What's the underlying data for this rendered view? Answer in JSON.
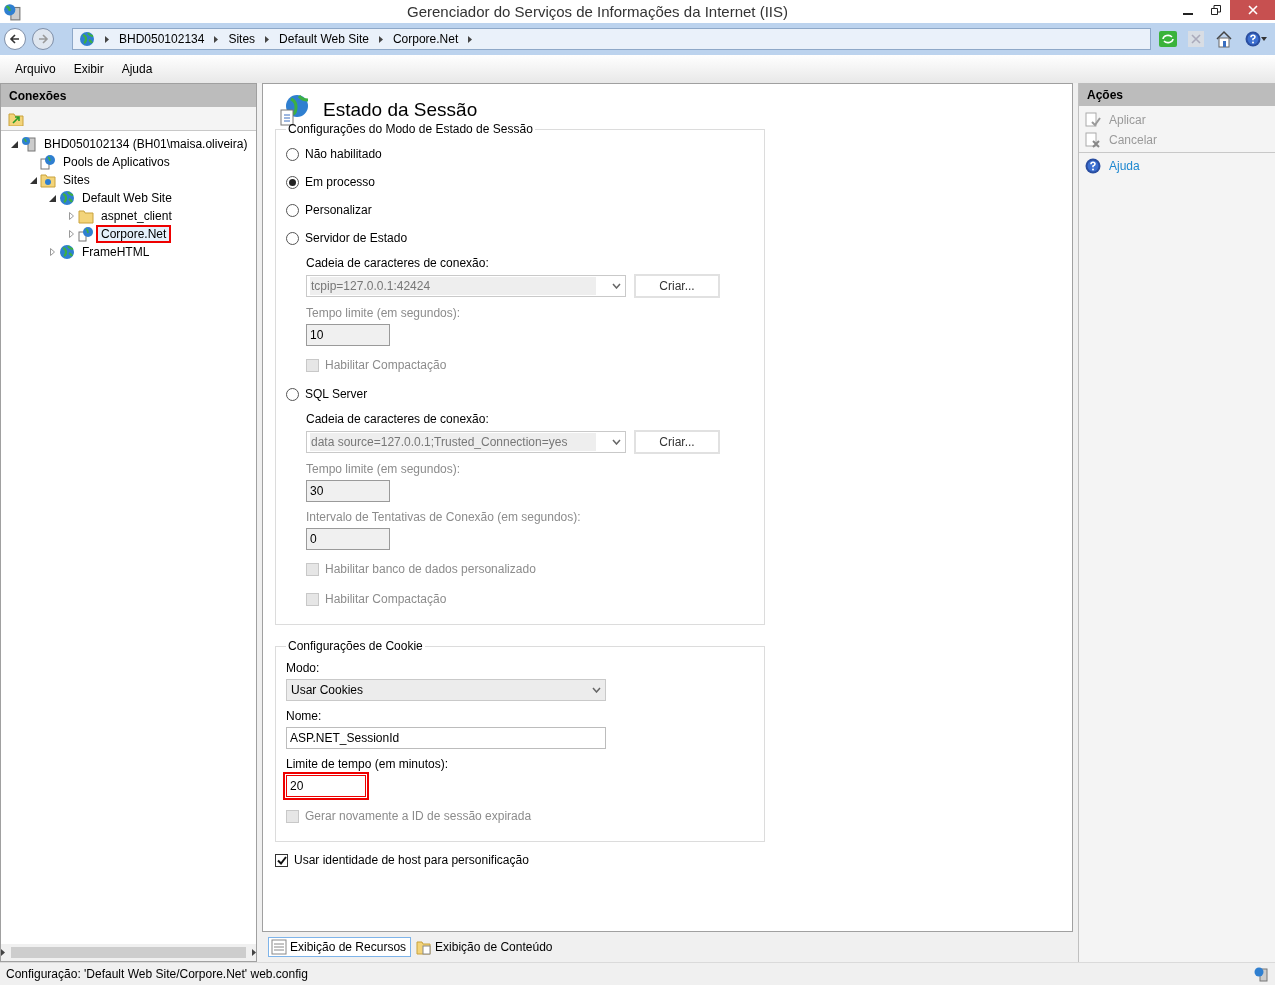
{
  "window": {
    "title": "Gerenciador do Serviços de Informações da Internet (IIS)"
  },
  "breadcrumb": [
    "BHD050102134",
    "Sites",
    "Default Web Site",
    "Corpore.Net"
  ],
  "menu": [
    "Arquivo",
    "Exibir",
    "Ajuda"
  ],
  "connections": {
    "title": "Conexões",
    "tree": [
      {
        "label": "BHD050102134 (BH01\\maisa.oliveira)",
        "kind": "server",
        "expanded": true,
        "selected": false,
        "annotated": false,
        "children": [
          {
            "label": "Pools de Aplicativos",
            "kind": "pools",
            "selected": false,
            "annotated": false
          },
          {
            "label": "Sites",
            "kind": "sites",
            "expanded": true,
            "selected": false,
            "annotated": false,
            "children": [
              {
                "label": "Default Web Site",
                "kind": "site",
                "expanded": true,
                "selected": false,
                "annotated": false,
                "children": [
                  {
                    "label": "aspnet_client",
                    "kind": "folder",
                    "expanded": false,
                    "selected": false,
                    "annotated": false
                  },
                  {
                    "label": "Corpore.Net",
                    "kind": "app",
                    "expanded": false,
                    "selected": true,
                    "annotated": true
                  }
                ]
              },
              {
                "label": "FrameHTML",
                "kind": "site",
                "expanded": false,
                "selected": false,
                "annotated": false
              }
            ]
          }
        ]
      }
    ]
  },
  "page": {
    "title": "Estado da Sessão",
    "session_state": {
      "legend": "Configurações do Modo de Estado de Sessão",
      "modes": [
        {
          "label": "Não habilitado",
          "selected": false
        },
        {
          "label": "Em processo",
          "selected": true
        },
        {
          "label": "Personalizar",
          "selected": false
        },
        {
          "label": "Servidor de Estado",
          "selected": false,
          "settings": [
            {
              "kind": "combo",
              "label": "Cadeia de caracteres de conexão:",
              "value": "tcpip=127.0.0.1:42424",
              "button": "Criar...",
              "disabled": true
            },
            {
              "kind": "text",
              "label": "Tempo limite (em segundos):",
              "value": "10",
              "disabled": true
            },
            {
              "kind": "checkbox",
              "label": "Habilitar Compactação",
              "checked": false,
              "disabled": true
            }
          ]
        },
        {
          "label": "SQL Server",
          "selected": false,
          "settings": [
            {
              "kind": "combo",
              "label": "Cadeia de caracteres de conexão:",
              "value": "data source=127.0.0.1;Trusted_Connection=yes",
              "button": "Criar...",
              "disabled": true
            },
            {
              "kind": "text",
              "label": "Tempo limite (em segundos):",
              "value": "30",
              "disabled": true
            },
            {
              "kind": "text",
              "label": "Intervalo de Tentativas de Conexão (em segundos):",
              "value": "0",
              "disabled": true
            },
            {
              "kind": "checkbox",
              "label": "Habilitar banco de dados personalizado",
              "checked": false,
              "disabled": true
            },
            {
              "kind": "checkbox",
              "label": "Habilitar Compactação",
              "checked": false,
              "disabled": true
            }
          ]
        }
      ]
    },
    "cookie": {
      "legend": "Configurações de Cookie",
      "fields": [
        {
          "kind": "select",
          "label": "Modo:",
          "value": "Usar Cookies"
        },
        {
          "kind": "text",
          "label": "Nome:",
          "value": "ASP.NET_SessionId"
        },
        {
          "kind": "number",
          "label": "Limite de tempo (em minutos):",
          "value": "20",
          "annotated": true
        },
        {
          "kind": "checkbox",
          "label": "Gerar novamente a ID de sessão expirada",
          "checked": false,
          "disabled": true
        }
      ]
    },
    "host_identity": {
      "label": "Usar identidade de host para personificação",
      "checked": true
    }
  },
  "view_tabs": [
    {
      "label": "Exibição de Recursos",
      "selected": true
    },
    {
      "label": "Exibição de Conteúdo",
      "selected": false
    }
  ],
  "actions": {
    "title": "Ações",
    "items": [
      {
        "label": "Aplicar",
        "kind": "apply",
        "disabled": true
      },
      {
        "label": "Cancelar",
        "kind": "cancel",
        "disabled": true
      },
      {
        "label": "Ajuda",
        "kind": "help",
        "disabled": false
      }
    ]
  },
  "status_bar": "Configuração: 'Default Web Site/Corpore.Net' web.config"
}
